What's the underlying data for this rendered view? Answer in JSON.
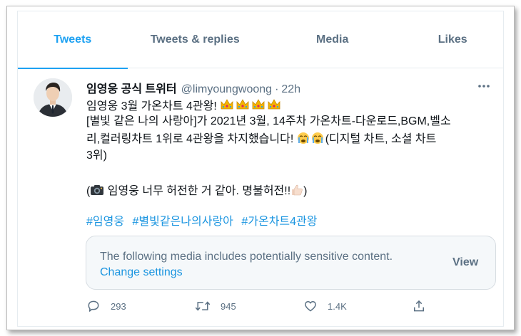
{
  "tabs": [
    {
      "label": "Tweets",
      "active": true
    },
    {
      "label": "Tweets & replies",
      "active": false
    },
    {
      "label": "Media",
      "active": false
    },
    {
      "label": "Likes",
      "active": false
    }
  ],
  "tweet": {
    "display_name": "임영웅 공식 트위터",
    "handle": "@limyoungwoong",
    "separator": "·",
    "time": "22h",
    "lines": {
      "line1": "임영웅 3월 가온차트 4관왕!",
      "line2": "[별빛 같은 나의 사랑아]가 2021년 3월, 14주차 가온차트-다운로드,BGM,벨소",
      "line3": "리,컬러링차트 1위로 4관왕을 차지했습니다!",
      "line3_tail": "(디지털 차트,  소셜 차트",
      "line4": "3위)",
      "line5_open": "(",
      "line5": "임영웅 너무 허전한 거 같아. 명불허전!!",
      "line5_close": ")"
    },
    "hashtags": [
      "#임영웅",
      "#별빛같은나의사랑아",
      "#가온차트4관왕"
    ]
  },
  "sensitive_notice": {
    "message": "The following media includes potentially sensitive content.",
    "change_link": "Change settings",
    "view_label": "View"
  },
  "actions": {
    "reply_count": "293",
    "retweet_count": "945",
    "like_count": "1.4K"
  },
  "colors": {
    "accent": "#1da1f2",
    "link": "#1b95e0",
    "muted": "#5b7083",
    "text": "#0f1419"
  },
  "icons": [
    "more-icon",
    "crown-icon",
    "crying-face-icon",
    "camera-icon",
    "thumbs-up-icon",
    "reply-icon",
    "retweet-icon",
    "like-icon",
    "share-icon"
  ]
}
